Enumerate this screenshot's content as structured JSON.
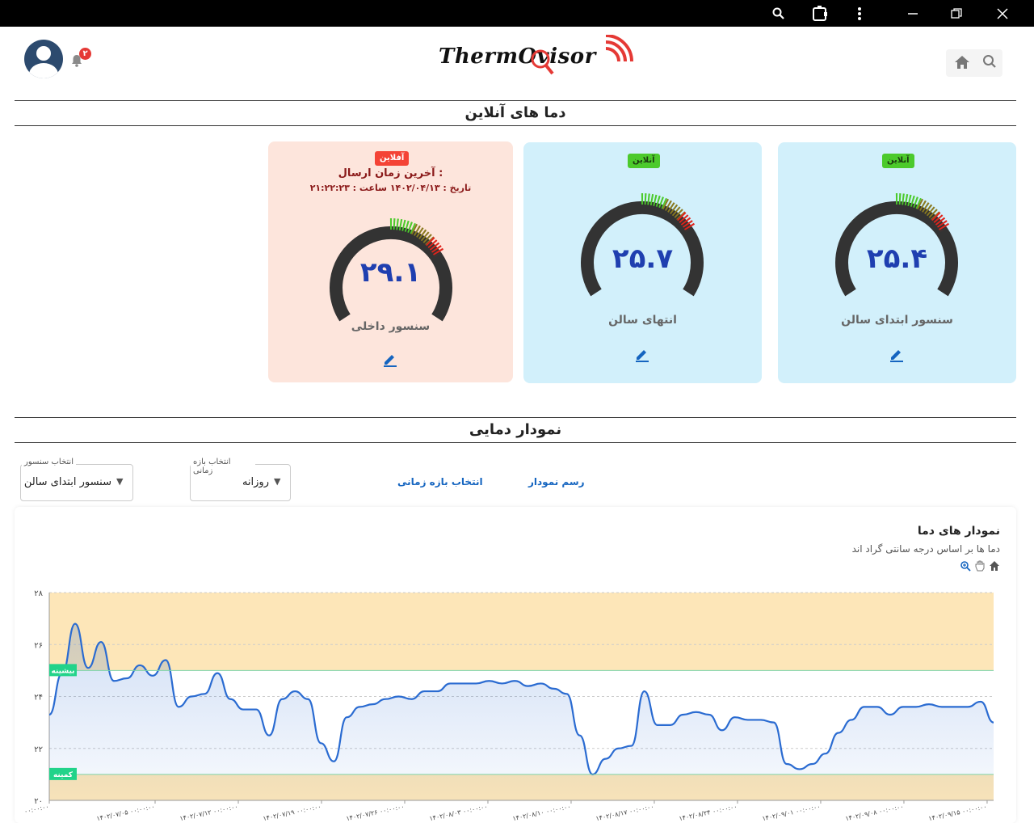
{
  "window_controls": {
    "search": "⚲",
    "extension": "⧉",
    "menu": "⋮",
    "minimize": "–",
    "restore": "❐",
    "close": "✕"
  },
  "header": {
    "logo_text": "ThermOvisor",
    "notifications_count": "۲"
  },
  "online_title": "دما های آنلاین",
  "sensors": [
    {
      "name": "سنسور ابتدای سالن",
      "value": "۲۵.۴",
      "value_num": 25.4,
      "status": "آنلاین",
      "online": true
    },
    {
      "name": "انتهای سالن",
      "value": "۲۵.۷",
      "value_num": 25.7,
      "status": "آنلاین",
      "online": true
    },
    {
      "name": "سنسور داخلی",
      "value": "۲۹.۱",
      "value_num": 29.1,
      "status": "آفلاین",
      "online": false,
      "last_send_label": "آخرین زمان ارسال :",
      "last_send_detail": "تاریخ : ۱۴۰۲/۰۴/۱۳ ساعت : ۲۱:۲۲:۲۳"
    }
  ],
  "chart_section_title": "نمودار دمایی",
  "controls": {
    "sensor_select_label": "انتخاب سنسور",
    "sensor_select_value": "سنسور ابتدای سالن",
    "range_select_label": "انتخاب بازه زمانی",
    "range_select_value": "روزانه",
    "range_button": "انتخاب بازه زمانی",
    "draw_button": "رسم نمودار"
  },
  "chart_card": {
    "title": "نمودار های دما",
    "subtitle": "دما ها بر اساس درجه سانتی گراد اند"
  },
  "colors": {
    "accent": "#2a6bd1",
    "band": "#fde6b8",
    "online_bg": "#d2f0fb",
    "offline_bg": "#fde5dc",
    "limit_badge": "#22d38a"
  },
  "chart_data": {
    "type": "area",
    "ylim": [
      20,
      28
    ],
    "yticks": [
      "۲۰",
      "۲۲",
      "۲۴",
      "۲۶",
      "۲۸"
    ],
    "xticks": [
      "۰۰:۰۰:۰۰",
      "۱۴۰۲/۰۷/۰۵ ۰۰:۰۰:۰۰",
      "۱۴۰۲/۰۷/۱۲ ۰۰:۰۰:۰۰",
      "۱۴۰۲/۰۷/۱۹ ۰۰:۰۰:۰۰",
      "۱۴۰۲/۰۷/۲۶ ۰۰:۰۰:۰۰",
      "۱۴۰۲/۰۸/۰۳ ۰۰:۰۰:۰۰",
      "۱۴۰۲/۰۸/۱۰ ۰۰:۰۰:۰۰",
      "۱۴۰۲/۰۸/۱۷ ۰۰:۰۰:۰۰",
      "۱۴۰۲/۰۸/۲۴ ۰۰:۰۰:۰۰",
      "۱۴۰۲/۰۹/۰۱ ۰۰:۰۰:۰۰",
      "۱۴۰۲/۰۹/۰۸ ۰۰:۰۰:۰۰",
      "۱۴۰۲/۰۹/۱۵ ۰۰:۰۰:۰۰"
    ],
    "max_limit": 25,
    "min_limit": 21,
    "max_label": "بیشینه",
    "min_label": "کمینه",
    "values": [
      23.3,
      24.9,
      26.8,
      25.1,
      26.1,
      24.6,
      24.7,
      25.2,
      24.8,
      25.4,
      23.6,
      24.0,
      24.1,
      24.9,
      23.9,
      23.5,
      23.5,
      22.5,
      23.9,
      24.2,
      23.9,
      22.2,
      21.5,
      23.2,
      23.6,
      23.7,
      23.9,
      24.0,
      23.9,
      24.2,
      24.2,
      24.5,
      24.5,
      24.5,
      24.6,
      24.5,
      24.6,
      24.4,
      24.5,
      24.3,
      24.1,
      22.5,
      21.0,
      21.6,
      22.0,
      22.1,
      24.2,
      22.9,
      22.9,
      23.3,
      23.4,
      23.3,
      22.7,
      23.2,
      23.1,
      23.1,
      23.0,
      21.4,
      21.2,
      21.4,
      21.8,
      22.6,
      23.1,
      23.6,
      23.6,
      23.3,
      23.6,
      23.6,
      23.7,
      23.6,
      23.6,
      23.6,
      23.8,
      23.0
    ]
  }
}
